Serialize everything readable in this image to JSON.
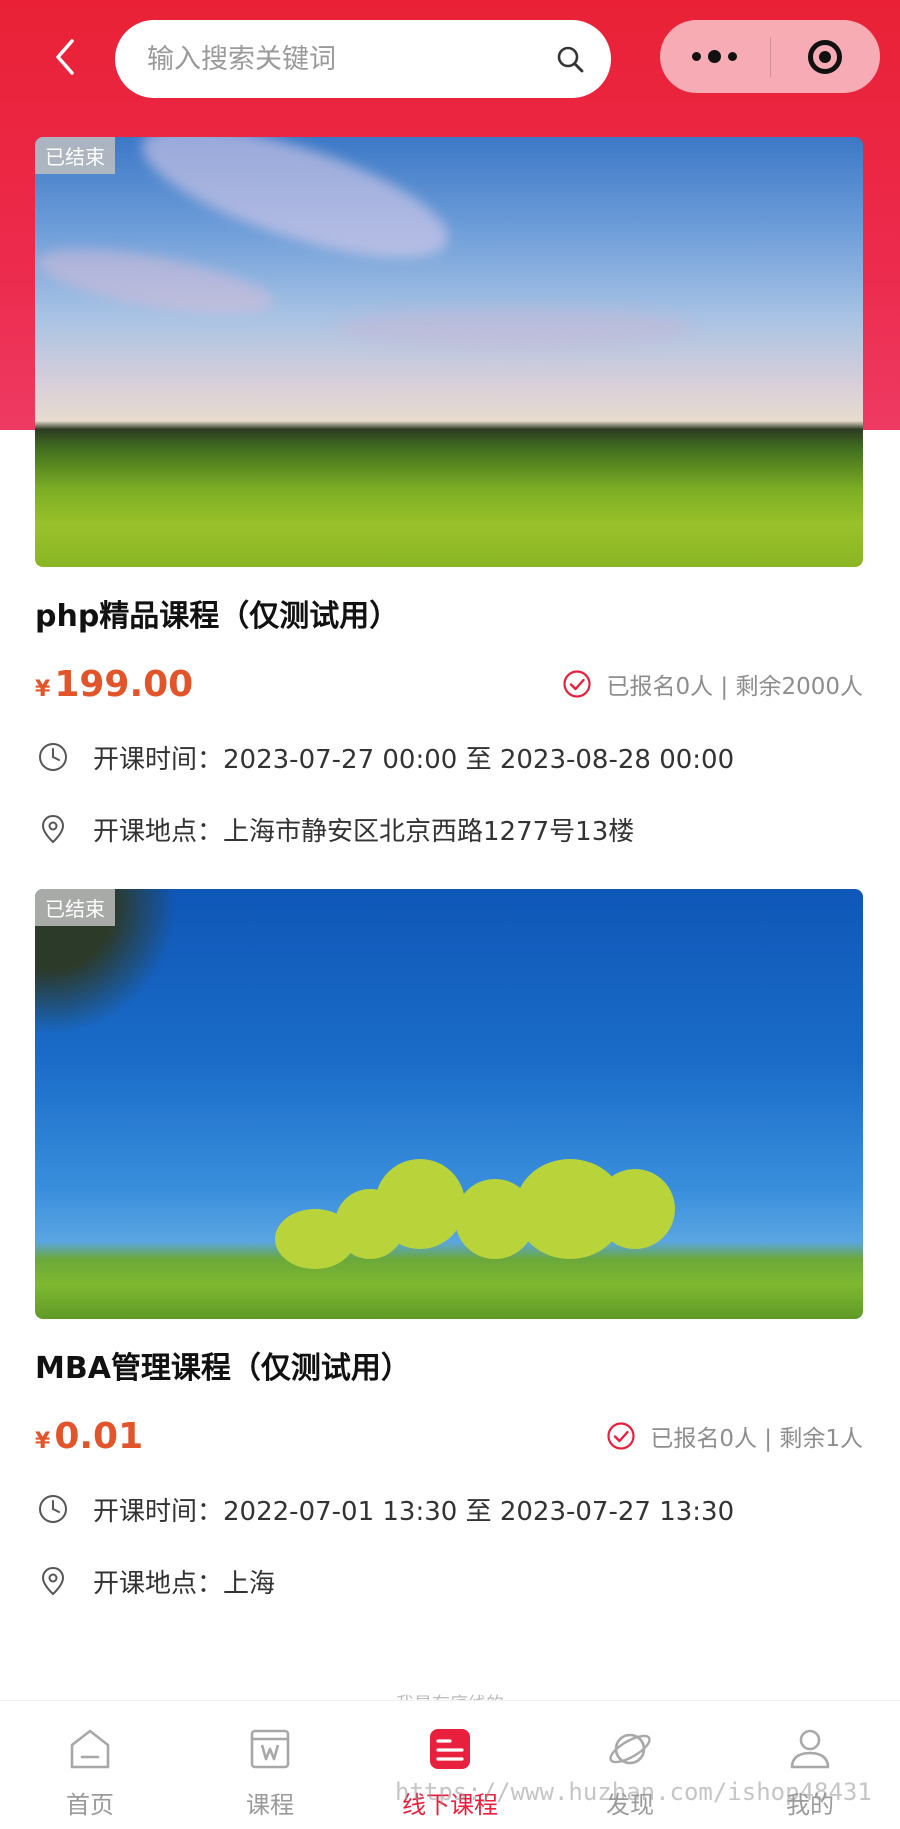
{
  "header": {
    "search_placeholder": "输入搜索关键词"
  },
  "courses": [
    {
      "status": "已结束",
      "title": "php精品课程（仅测试用）",
      "currency": "¥",
      "price": "199.00",
      "enroll_text": "已报名0人 | 剩余2000人",
      "time_label": "开课时间：",
      "time_value": "2023-07-27 00:00 至 2023-08-28 00:00",
      "addr_label": "开课地点：",
      "addr_value": "上海市静安区北京西路1277号13楼"
    },
    {
      "status": "已结束",
      "title": "MBA管理课程（仅测试用）",
      "currency": "¥",
      "price": "0.01",
      "enroll_text": "已报名0人 | 剩余1人",
      "time_label": "开课时间：",
      "time_value": "2022-07-01 13:30 至 2023-07-27 13:30",
      "addr_label": "开课地点：",
      "addr_value": "上海"
    }
  ],
  "footer_hint": "我是有底线的",
  "tabbar": {
    "items": [
      {
        "label": "首页",
        "icon": "home-icon"
      },
      {
        "label": "课程",
        "icon": "course-icon"
      },
      {
        "label": "线下课程",
        "icon": "offline-course-icon",
        "active": true
      },
      {
        "label": "发现",
        "icon": "planet-icon"
      },
      {
        "label": "我的",
        "icon": "user-icon"
      }
    ]
  },
  "watermark": "https://www.huzhan.com/ishop48431",
  "colors": {
    "brand_red": "#e8203d",
    "price_orange": "#e2542a",
    "muted_gray": "#9a9a9a"
  }
}
